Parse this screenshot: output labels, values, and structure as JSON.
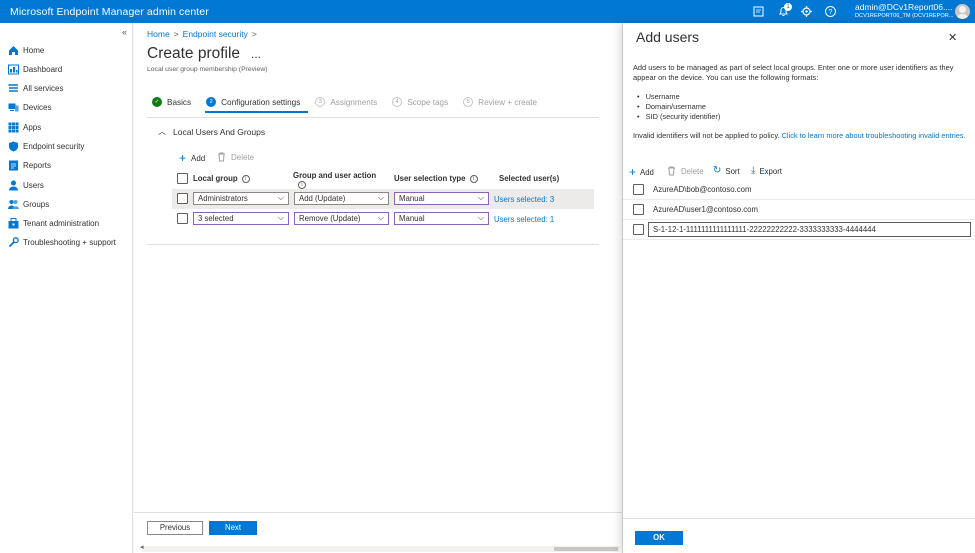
{
  "topbar": {
    "title": "Microsoft Endpoint Manager admin center",
    "notification_count": "1",
    "account_name": "admin@DCv1Report06....",
    "tenant_name": "DCV1REPORT06_TM (DCV1REPOR...",
    "icons": [
      "feedback-icon",
      "bell-icon",
      "gear-icon",
      "help-icon",
      "avatar"
    ]
  },
  "nav": {
    "collapse_label": "«",
    "items": [
      {
        "label": "Home",
        "icon": "home-icon"
      },
      {
        "label": "Dashboard",
        "icon": "dashboard-icon"
      },
      {
        "label": "All services",
        "icon": "all-services-icon"
      },
      {
        "label": "Devices",
        "icon": "devices-icon"
      },
      {
        "label": "Apps",
        "icon": "apps-icon"
      },
      {
        "label": "Endpoint security",
        "icon": "endpoint-security-icon"
      },
      {
        "label": "Reports",
        "icon": "reports-icon"
      },
      {
        "label": "Users",
        "icon": "users-icon"
      },
      {
        "label": "Groups",
        "icon": "groups-icon"
      },
      {
        "label": "Tenant administration",
        "icon": "tenant-admin-icon"
      },
      {
        "label": "Troubleshooting + support",
        "icon": "troubleshooting-icon"
      }
    ]
  },
  "main": {
    "breadcrumb": [
      "Home",
      "Endpoint security"
    ],
    "title": "Create profile",
    "more": "...",
    "subtitle": "Local user group membership (Preview)",
    "steps": [
      {
        "num": "✓",
        "label": "Basics",
        "state": "done"
      },
      {
        "num": "2",
        "label": "Configuration settings",
        "state": "active"
      },
      {
        "num": "3",
        "label": "Assignments",
        "state": "todo"
      },
      {
        "num": "4",
        "label": "Scope tags",
        "state": "todo"
      },
      {
        "num": "5",
        "label": "Review + create",
        "state": "todo"
      }
    ],
    "section_title": "Local Users And Groups",
    "commands": {
      "add": "Add",
      "delete": "Delete"
    },
    "columns": [
      "Local group",
      "Group and user action",
      "User selection type",
      "Selected user(s)"
    ],
    "rows": [
      {
        "group": "Administrators",
        "action": "Add (Update)",
        "selection": "Manual",
        "users": "Users selected: 3"
      },
      {
        "group": "3 selected",
        "action": "Remove (Update)",
        "selection": "Manual",
        "users": "Users selected: 1"
      }
    ],
    "buttons": {
      "previous": "Previous",
      "next": "Next"
    }
  },
  "panel": {
    "title": "Add users",
    "close": "✕",
    "description": "Add users to be managed as part of select local groups. Enter one or more user identifiers as they appear on the device. You can use the following formats:",
    "formats": [
      "Username",
      "Domain/username",
      "SID (security identifier)"
    ],
    "invalid_text": "Invalid identifiers will not be applied to policy.",
    "invalid_link": "Click to learn more about troubleshooting invalid entries.",
    "commands": {
      "add": "Add",
      "delete": "Delete",
      "sort": "Sort",
      "export": "Export"
    },
    "users": [
      "AzureAD\\bob@contoso.com",
      "AzureAD\\user1@contoso.com"
    ],
    "input_value": "S-1-12-1-1111111111111111-22222222222-3333333333-4444444",
    "ok": "OK"
  },
  "colors": {
    "accent": "#0078d4",
    "success": "#107c10",
    "dropdown_border_highlight": "#8764b8"
  }
}
